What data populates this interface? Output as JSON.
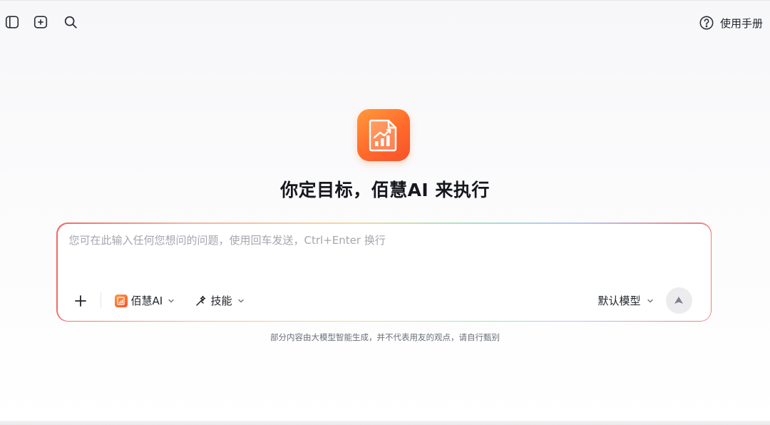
{
  "toolbar": {
    "sidebar_toggle_icon": "sidebar-panel-icon",
    "new_chat_icon": "plus-square-icon",
    "search_icon": "search-icon",
    "help_label": "使用手册",
    "help_icon": "question-circle-icon"
  },
  "hero": {
    "logo_icon": "report-chart-icon",
    "headline": "你定目标，佰慧AI 来执行",
    "brand_color": "#ff6a2b"
  },
  "input": {
    "placeholder": "您可在此输入任何您想问的问题，使用回车发送，Ctrl+Enter 换行",
    "value": "",
    "attach_icon": "plus-icon",
    "agent_label": "佰慧AI",
    "skills_label": "技能",
    "skills_icon": "wand-icon",
    "model_label": "默认模型",
    "send_icon": "send-arrow-icon"
  },
  "footer": {
    "disclaimer": "部分内容由大模型智能生成，并不代表用友的观点，请自行甄别"
  }
}
